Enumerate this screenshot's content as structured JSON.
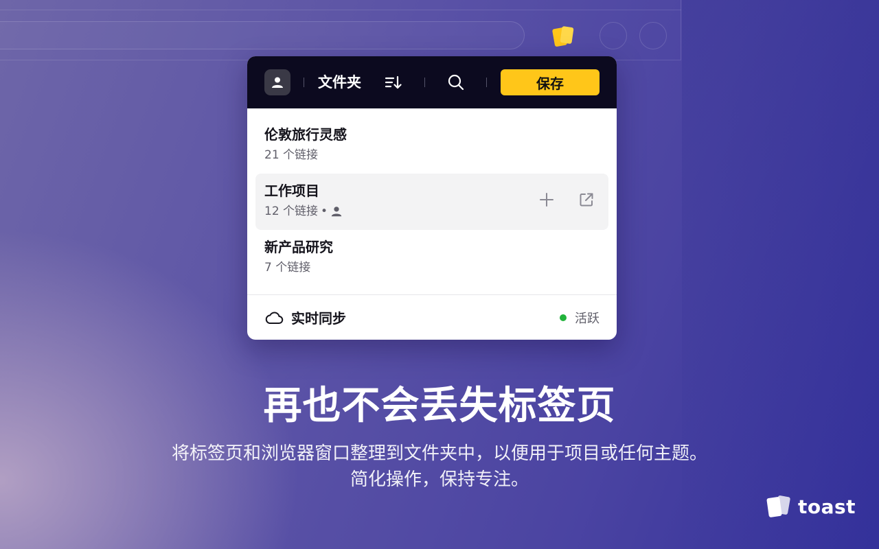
{
  "colors": {
    "accent": "#ffc619",
    "toolbar_bg": "#0c0a1f",
    "active_status": "#22b33b"
  },
  "toolbar": {
    "avatar_icon": "user-icon",
    "folder_title": "文件夹",
    "sort_icon": "sort-icon",
    "search_icon": "search-icon",
    "save_label": "保存"
  },
  "folders": [
    {
      "name": "伦敦旅行灵感",
      "meta": "21 个链接",
      "shared": false
    },
    {
      "name": "工作项目",
      "meta": "12 个链接",
      "shared": true,
      "shared_separator": "•"
    },
    {
      "name": "新产品研究",
      "meta": "7 个链接",
      "shared": false
    }
  ],
  "footer": {
    "cloud_icon": "cloud-icon",
    "sync_label": "实时同步",
    "status_label": "活跃"
  },
  "hero": {
    "headline": "再也不会丢失标签页",
    "subline_1": "将标签页和浏览器窗口整理到文件夹中，以便用于项目或任何主题。",
    "subline_2": "简化操作，保持专注。"
  },
  "brand": {
    "name": "toast",
    "logo_icon": "toast-logo-icon"
  }
}
